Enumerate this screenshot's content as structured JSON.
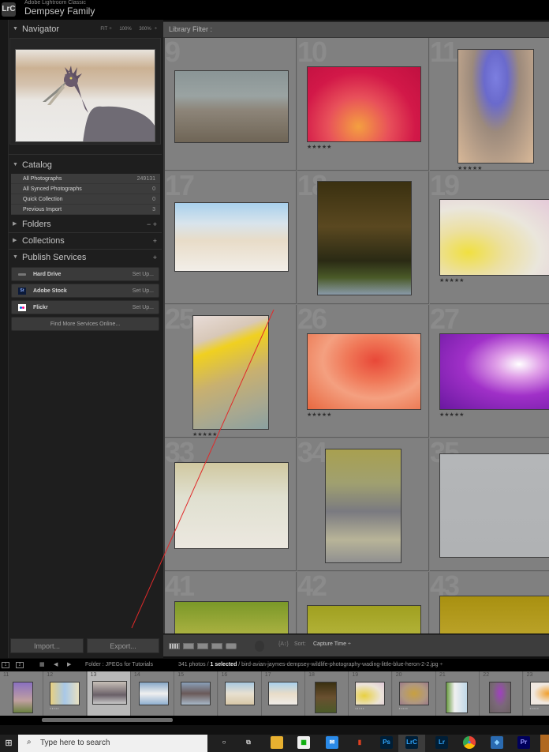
{
  "window": {
    "app_name": "Adobe Lightroom Classic",
    "catalog_name": "Dempsey Family",
    "logo": "LrC"
  },
  "navigator": {
    "title": "Navigator",
    "zoom_options": [
      "FIT",
      "100%",
      "300%"
    ],
    "image": "little-blue-heron-with-fish"
  },
  "catalog": {
    "title": "Catalog",
    "items": [
      {
        "label": "All Photographs",
        "count": "249131"
      },
      {
        "label": "All Synced Photographs",
        "count": "0"
      },
      {
        "label": "Quick Collection",
        "count": "0"
      },
      {
        "label": "Previous Import",
        "count": "3"
      }
    ]
  },
  "folders": {
    "title": "Folders",
    "actions": "− +"
  },
  "collections": {
    "title": "Collections",
    "actions": "+"
  },
  "publish_services": {
    "title": "Publish Services",
    "actions": "+",
    "services": [
      {
        "label": "Hard Drive",
        "action": "Set Up...",
        "icon": "hard-drive-icon"
      },
      {
        "label": "Adobe Stock",
        "action": "Set Up...",
        "icon": "adobe-stock-icon"
      },
      {
        "label": "Flickr",
        "action": "Set Up...",
        "icon": "flickr-icon"
      }
    ],
    "find_more": "Find More Services Online..."
  },
  "buttons": {
    "import": "Import...",
    "export": "Export..."
  },
  "library_filter": {
    "label": "Library Filter :"
  },
  "grid": {
    "cells": [
      {
        "num": "9",
        "subject": "sanderlings-on-beach",
        "stars": ""
      },
      {
        "num": "10",
        "subject": "red-flower-stamens",
        "stars": "★★★★★"
      },
      {
        "num": "11",
        "subject": "purple-flower",
        "stars": "★★★★★"
      },
      {
        "num": "17",
        "subject": "plover-in-flowers",
        "stars": ""
      },
      {
        "num": "18",
        "subject": "reddish-egret",
        "stars": ""
      },
      {
        "num": "19",
        "subject": "tulip-macro",
        "stars": "★★★★★"
      },
      {
        "num": "25",
        "subject": "yellow-petal",
        "stars": "★★★★★"
      },
      {
        "num": "26",
        "subject": "orange-rose",
        "stars": "★★★★★"
      },
      {
        "num": "27",
        "subject": "purple-clematis",
        "stars": "★★★★★"
      },
      {
        "num": "33",
        "subject": "great-egret",
        "stars": ""
      },
      {
        "num": "34",
        "subject": "brown-pelicans",
        "stars": ""
      },
      {
        "num": "35",
        "subject": "oystercatcher",
        "stars": ""
      },
      {
        "num": "41",
        "subject": "tricolored-heron",
        "stars": ""
      },
      {
        "num": "42",
        "subject": "roseate-spoonbill",
        "stars": ""
      },
      {
        "num": "43",
        "subject": "oystercatcher-preening",
        "stars": ""
      }
    ]
  },
  "toolbar": {
    "sort_label": "Sort:",
    "sort_value": "Capture Time ÷",
    "view_modes": [
      "grid-view",
      "loupe-view",
      "compare-view",
      "survey-view",
      "people-view"
    ]
  },
  "filmstrip_bar": {
    "monitor1": "1",
    "monitor2": "2",
    "folder": "Folder : JPEGs for Tutorials",
    "count": "341 photos /",
    "selected": "1 selected",
    "filename": "/ bird-avian-jaymes-dempsey-wildlife-photography-wading-little-blue-heron-2-2.jpg ÷"
  },
  "filmstrip": {
    "cells": [
      {
        "num": "11",
        "stars": "•••••",
        "selected": false
      },
      {
        "num": "12",
        "stars": "•••••",
        "selected": false
      },
      {
        "num": "13",
        "stars": "",
        "selected": true
      },
      {
        "num": "14",
        "stars": "",
        "selected": false
      },
      {
        "num": "15",
        "stars": "",
        "selected": false
      },
      {
        "num": "16",
        "stars": "",
        "selected": false
      },
      {
        "num": "17",
        "stars": "",
        "selected": false
      },
      {
        "num": "18",
        "stars": "",
        "selected": false
      },
      {
        "num": "19",
        "stars": "•••••",
        "selected": false
      },
      {
        "num": "20",
        "stars": "•••••",
        "selected": false
      },
      {
        "num": "21",
        "stars": "•••••",
        "selected": false
      },
      {
        "num": "22",
        "stars": "•••••",
        "selected": false
      },
      {
        "num": "23",
        "stars": "•••••",
        "selected": false
      }
    ]
  },
  "taskbar": {
    "search_placeholder": "Type here to search",
    "apps": [
      "Cortana",
      "Task View",
      "File Explorer",
      "Microsoft Store",
      "Mail",
      "Office",
      "Ps",
      "LrC",
      "Lr",
      "Chrome",
      "3D app",
      "Pr"
    ]
  },
  "colors": {
    "annotation_line": "#e02a2a",
    "panel_bg": "#1e1e1e",
    "grid_bg": "#808080"
  }
}
